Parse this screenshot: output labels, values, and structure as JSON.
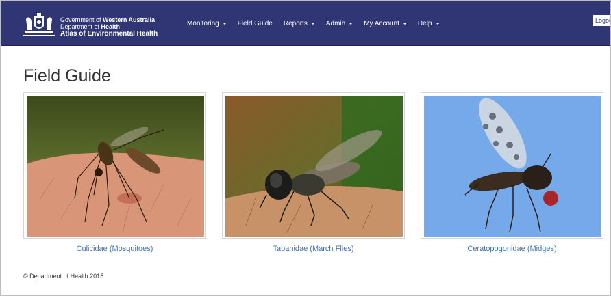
{
  "header": {
    "brand_line1_prefix": "Government of ",
    "brand_line1_bold": "Western Australia",
    "brand_line2_prefix": "Department of ",
    "brand_line2_bold": "Health",
    "brand_line3": "Atlas of Environmental Health",
    "logout_label": "Logout"
  },
  "nav": [
    {
      "label": "Monitoring",
      "dropdown": true
    },
    {
      "label": "Field Guide",
      "dropdown": false
    },
    {
      "label": "Reports",
      "dropdown": true
    },
    {
      "label": "Admin",
      "dropdown": true
    },
    {
      "label": "My Account",
      "dropdown": true
    },
    {
      "label": "Help",
      "dropdown": true
    }
  ],
  "main": {
    "title": "Field Guide",
    "cards": [
      {
        "caption": "Culicidae (Mosquitoes)",
        "image": "mosquito-photo"
      },
      {
        "caption": "Tabanidae (March Flies)",
        "image": "march-fly-photo"
      },
      {
        "caption": "Ceratopogonidae (Midges)",
        "image": "midge-photo"
      }
    ]
  },
  "footer": {
    "copyright": "© Department of Health 2015"
  },
  "colors": {
    "navbar": "#2f3673",
    "link": "#3a73b8",
    "title": "#333333"
  }
}
